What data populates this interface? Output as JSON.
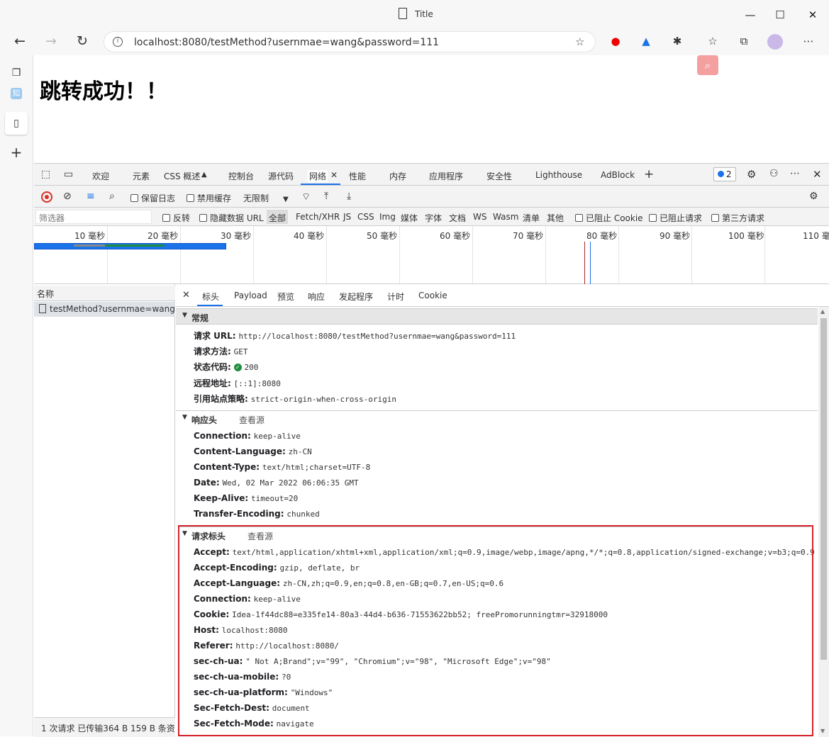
{
  "window": {
    "title": "Title"
  },
  "browser": {
    "url": "localhost:8080/testMethod?usernmae=wang&password=111"
  },
  "page": {
    "heading": "跳转成功！！"
  },
  "sidebar": {
    "items": [
      "tabs-icon",
      "zhihu-icon",
      "page-icon",
      "add-icon"
    ],
    "zhihu_label": "知"
  },
  "devtools": {
    "tabs": [
      "欢迎",
      "元素",
      "CSS 概述",
      "控制台",
      "源代码",
      "网络",
      "性能",
      "内存",
      "应用程序",
      "安全性",
      "Lighthouse",
      "AdBlock"
    ],
    "issues_count": "2",
    "net_toolbar": {
      "preserve_log": "保留日志",
      "disable_cache": "禁用缓存",
      "throttle": "无限制"
    },
    "filter": {
      "placeholder": "筛选器",
      "invert": "反转",
      "hide_data_url": "隐藏数据 URL",
      "types": [
        "全部",
        "Fetch/XHR",
        "JS",
        "CSS",
        "Img",
        "媒体",
        "字体",
        "文档",
        "WS",
        "Wasm",
        "清单",
        "其他"
      ],
      "blocked_cookies": "已阻止 Cookie",
      "blocked_requests": "已阻止请求",
      "third_party": "第三方请求"
    },
    "timeline": {
      "labels": [
        "10 毫秒",
        "20 毫秒",
        "30 毫秒",
        "40 毫秒",
        "50 毫秒",
        "60 毫秒",
        "70 毫秒",
        "80 毫秒",
        "90 毫秒",
        "100 毫秒",
        "110 毫"
      ]
    },
    "request_list": {
      "header": "名称",
      "row": "testMethod?usernmae=wang...",
      "status": "1 次请求  已传输364 B  159 B 条资源"
    },
    "detail_tabs": [
      "标头",
      "Payload",
      "预览",
      "响应",
      "发起程序",
      "计时",
      "Cookie"
    ],
    "general": {
      "title": "常规",
      "rows": [
        {
          "k": "请求 URL:",
          "v": "http://localhost:8080/testMethod?usernmae=wang&password=111"
        },
        {
          "k": "请求方法:",
          "v": "GET"
        },
        {
          "k": "状态代码:",
          "v": "200"
        },
        {
          "k": "远程地址:",
          "v": "[::1]:8080"
        },
        {
          "k": "引用站点策略:",
          "v": "strict-origin-when-cross-origin"
        }
      ]
    },
    "response_headers": {
      "title": "响应头",
      "view_source": "查看源",
      "rows": [
        {
          "k": "Connection:",
          "v": "keep-alive"
        },
        {
          "k": "Content-Language:",
          "v": "zh-CN"
        },
        {
          "k": "Content-Type:",
          "v": "text/html;charset=UTF-8"
        },
        {
          "k": "Date:",
          "v": "Wed, 02 Mar 2022 06:06:35 GMT"
        },
        {
          "k": "Keep-Alive:",
          "v": "timeout=20"
        },
        {
          "k": "Transfer-Encoding:",
          "v": "chunked"
        }
      ]
    },
    "request_headers": {
      "title": "请求标头",
      "view_source": "查看源",
      "rows": [
        {
          "k": "Accept:",
          "v": "text/html,application/xhtml+xml,application/xml;q=0.9,image/webp,image/apng,*/*;q=0.8,application/signed-exchange;v=b3;q=0.9"
        },
        {
          "k": "Accept-Encoding:",
          "v": "gzip, deflate, br"
        },
        {
          "k": "Accept-Language:",
          "v": "zh-CN,zh;q=0.9,en;q=0.8,en-GB;q=0.7,en-US;q=0.6"
        },
        {
          "k": "Connection:",
          "v": "keep-alive"
        },
        {
          "k": "Cookie:",
          "v": "Idea-1f44dc88=e335fe14-80a3-44d4-b636-71553622bb52; freePromorunningtmr=32918000"
        },
        {
          "k": "Host:",
          "v": "localhost:8080"
        },
        {
          "k": "Referer:",
          "v": "http://localhost:8080/"
        },
        {
          "k": "sec-ch-ua:",
          "v": "\" Not A;Brand\";v=\"99\", \"Chromium\";v=\"98\", \"Microsoft Edge\";v=\"98\""
        },
        {
          "k": "sec-ch-ua-mobile:",
          "v": "?0"
        },
        {
          "k": "sec-ch-ua-platform:",
          "v": "\"Windows\""
        },
        {
          "k": "Sec-Fetch-Dest:",
          "v": "document"
        },
        {
          "k": "Sec-Fetch-Mode:",
          "v": "navigate"
        }
      ]
    }
  },
  "colors": {
    "accent": "#1a73e8",
    "highlight_border": "#d4232b",
    "status_ok": "#1e8e3e"
  }
}
